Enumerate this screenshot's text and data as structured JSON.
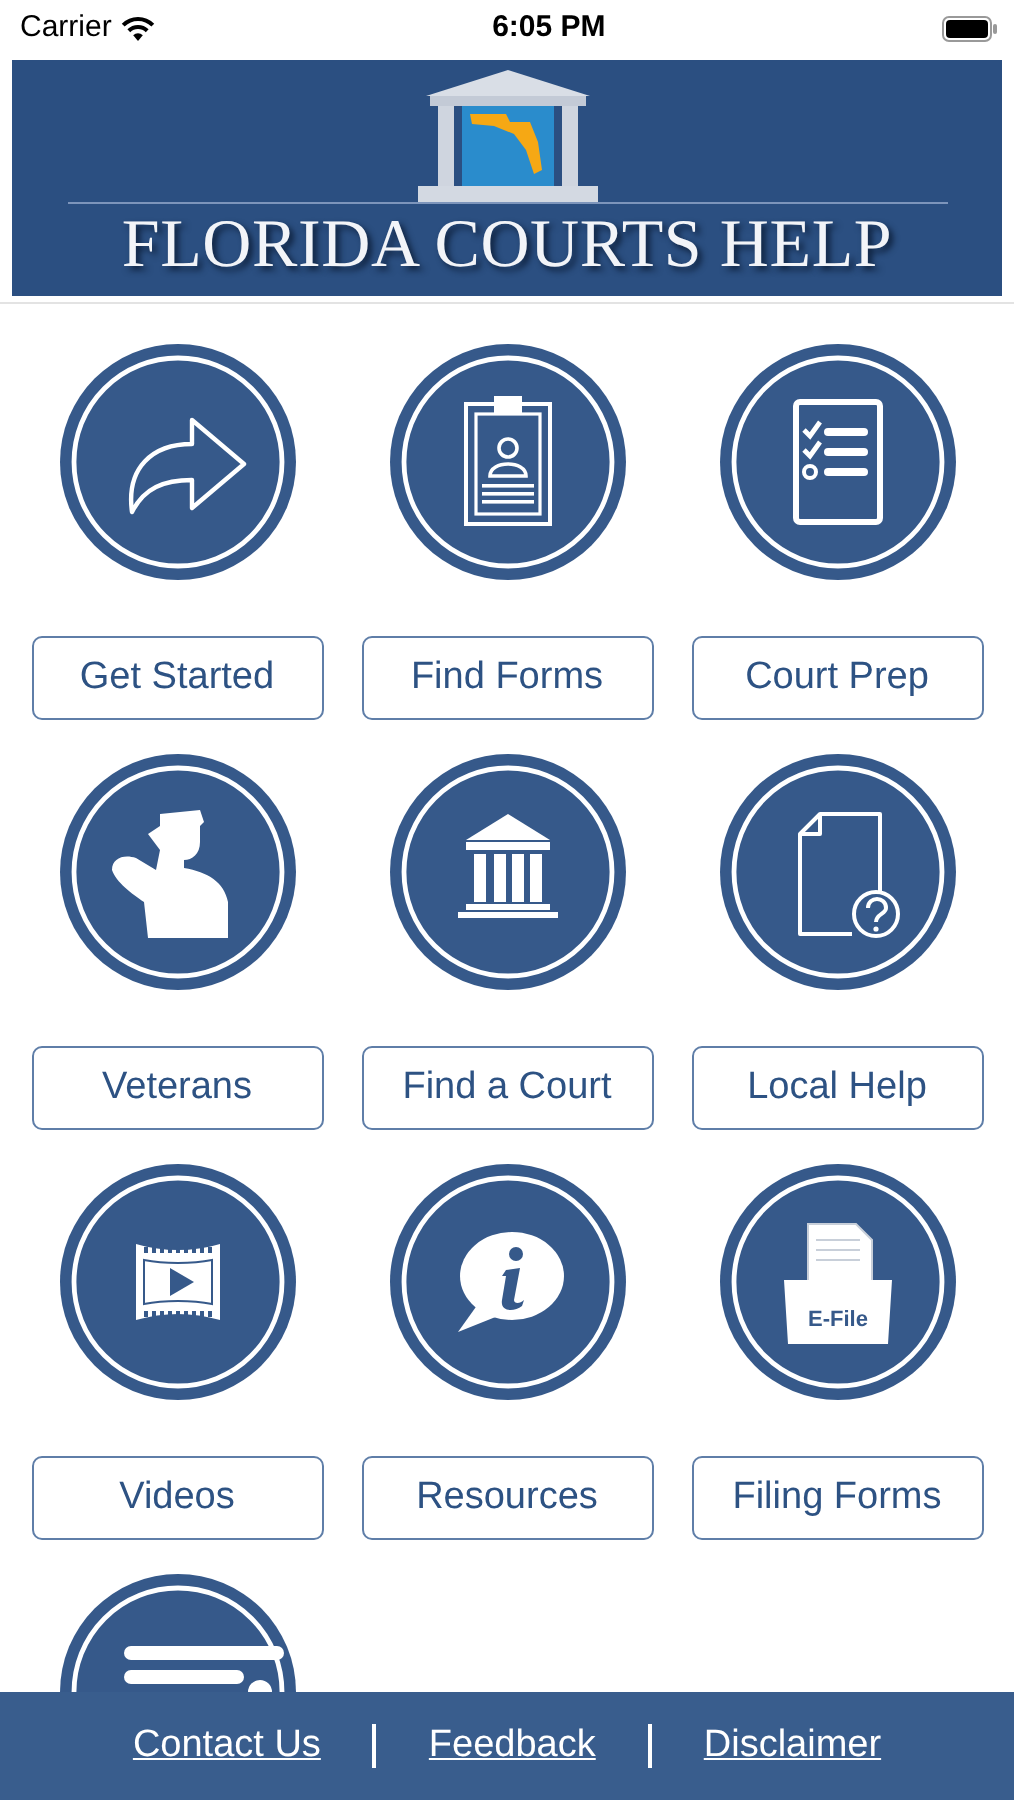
{
  "status_bar": {
    "carrier": "Carrier",
    "time": "6:05 PM"
  },
  "banner": {
    "title": "FLORIDA COURTS HELP"
  },
  "tile_rows": [
    [
      {
        "kind": "arrow",
        "label": "Get Started"
      },
      {
        "kind": "clipboard",
        "label": "Find Forms"
      },
      {
        "kind": "checklist",
        "label": "Court Prep"
      }
    ],
    [
      {
        "kind": "salute",
        "label": "Veterans"
      },
      {
        "kind": "courthouse",
        "label": "Find a Court"
      },
      {
        "kind": "question",
        "label": "Local Help"
      }
    ],
    [
      {
        "kind": "film",
        "label": "Videos"
      },
      {
        "kind": "info",
        "label": "Resources"
      },
      {
        "kind": "efile",
        "label": "Filing Forms",
        "icon_text": "E-File"
      }
    ],
    [
      {
        "kind": "list"
      }
    ]
  ],
  "footer_links": [
    "Contact Us",
    "Feedback",
    "Disclaimer"
  ]
}
